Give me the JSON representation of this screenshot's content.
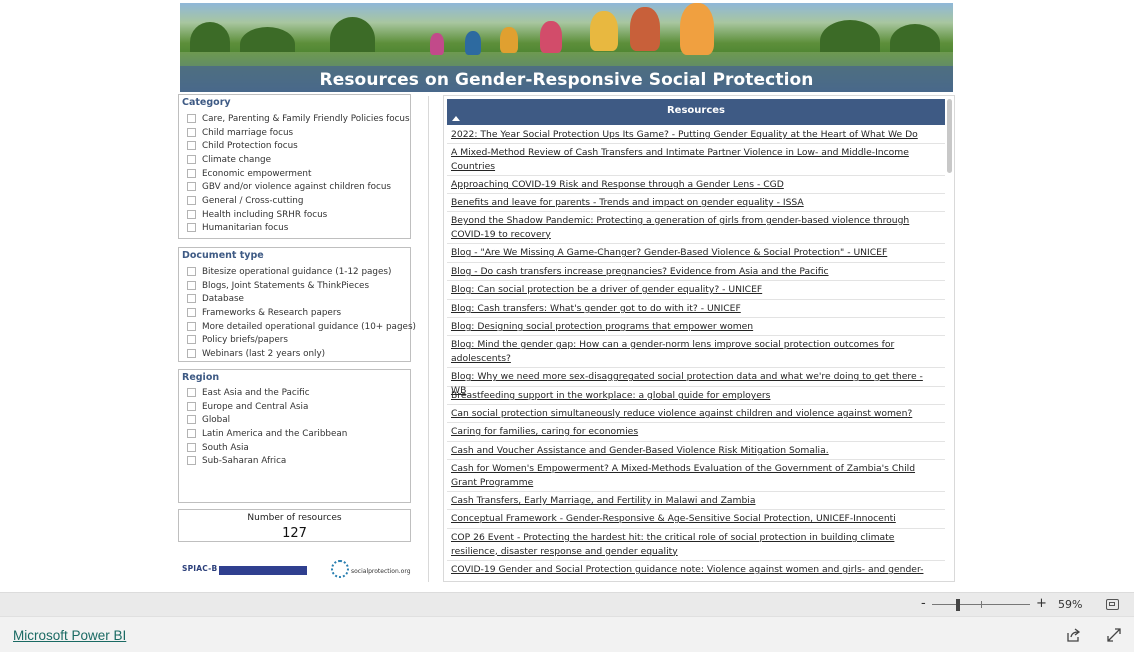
{
  "banner": {
    "title": "Resources on Gender-Responsive Social Protection"
  },
  "filters": {
    "category": {
      "title": "Category",
      "options": [
        "Care, Parenting & Family Friendly Policies focus",
        "Child marriage focus",
        "Child Protection focus",
        "Climate change",
        "Economic empowerment",
        "GBV and/or violence against children focus",
        "General / Cross-cutting",
        "Health including SRHR focus",
        "Humanitarian focus"
      ]
    },
    "document_type": {
      "title": "Document type",
      "options": [
        "Bitesize operational guidance (1-12 pages)",
        "Blogs, Joint Statements & ThinkPieces",
        "Database",
        "Frameworks & Research papers",
        "More detailed operational guidance (10+ pages)",
        "Policy briefs/papers",
        "Webinars (last 2 years only)"
      ]
    },
    "region": {
      "title": "Region",
      "options": [
        "East Asia and the Pacific",
        "Europe and Central Asia",
        "Global",
        "Latin America and the Caribbean",
        "South Asia",
        "Sub-Saharan Africa"
      ]
    }
  },
  "count_card": {
    "label": "Number of resources",
    "value": "127"
  },
  "logos": {
    "spiac": "SPIAC-B",
    "socialprotection": "socialprotection.org"
  },
  "resources": {
    "header": "Resources",
    "items": [
      "2022: The Year Social Protection Ups Its Game? - Putting Gender Equality at the Heart of What We Do",
      "A Mixed-Method Review of Cash Transfers and Intimate Partner Violence in Low- and Middle-Income Countries",
      "Approaching COVID-19 Risk and Response through a Gender Lens - CGD",
      "Benefits and leave for parents - Trends and impact on gender equality - ISSA",
      "Beyond the Shadow Pandemic: Protecting a generation of girls from gender-based violence through COVID-19 to recovery",
      "Blog - \"Are We Missing A Game-Changer? Gender-Based Violence & Social Protection\" - UNICEF",
      "Blog - Do cash transfers increase pregnancies? Evidence from Asia and the Pacific",
      "Blog: Can social protection be a driver of gender equality? - UNICEF",
      "Blog: Cash transfers: What's gender got to do with it? - UNICEF",
      "Blog: Designing social protection programs that empower women",
      "Blog: Mind the gender gap: How can a gender-norm lens improve social protection outcomes for adolescents?",
      "Blog: Why we need more sex-disaggregated social protection data and what we're doing to get there - WB",
      "Breastfeeding support in the workplace: a global guide for employers",
      "Can social protection simultaneously reduce violence against children and violence against women?",
      "Caring for families, caring for economies",
      "Cash and Voucher Assistance and Gender-Based Violence Risk Mitigation Somalia.",
      "Cash for Women's Empowerment? A Mixed-Methods Evaluation of the Government of Zambia's Child Grant Programme",
      "Cash Transfers, Early Marriage, and Fertility in Malawi and Zambia",
      "Conceptual Framework - Gender-Responsive & Age-Sensitive Social Protection, UNICEF-Innocenti",
      "COP 26 Event - Protecting the hardest hit: the critical role of social protection in building climate resilience, disaster response and gender equality",
      "COVID-19 Gender and Social Protection guidance note: Violence against women and girls- and gender-"
    ]
  },
  "zoom": {
    "minus": "-",
    "plus": "+",
    "percent": "59%"
  },
  "footer": {
    "brand_link": "Microsoft Power BI"
  }
}
